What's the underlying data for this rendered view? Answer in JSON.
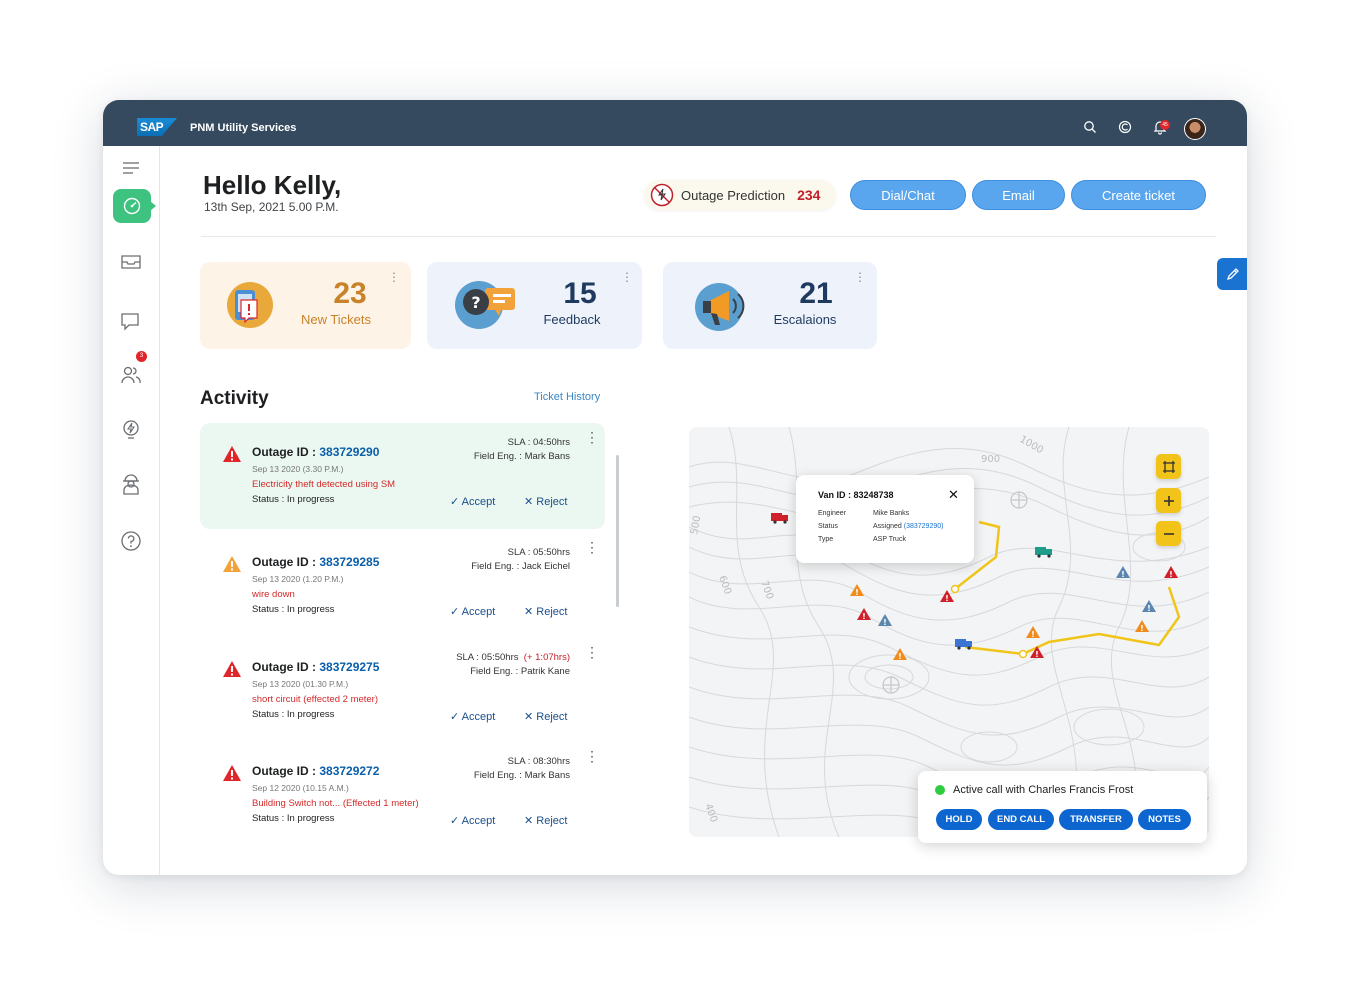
{
  "shell": {
    "logo_text": "SAP",
    "app_title": "PNM Utility Services",
    "notification_count": "45",
    "icons": [
      "search-icon",
      "copilot-icon",
      "bell-icon",
      "avatar"
    ]
  },
  "sidebar": {
    "items": [
      {
        "icon": "menu-icon"
      },
      {
        "icon": "dashboard-icon",
        "active": true
      },
      {
        "icon": "inbox-icon"
      },
      {
        "icon": "chat-icon",
        "badge": "3"
      },
      {
        "icon": "users-icon"
      },
      {
        "icon": "energy-icon"
      },
      {
        "icon": "engineer-icon"
      },
      {
        "icon": "help-icon"
      }
    ]
  },
  "header": {
    "greeting": "Hello Kelly,",
    "date": "13th Sep, 2021  5.00 P.M.",
    "outage_label": "Outage Prediction",
    "outage_value": "234",
    "buttons": {
      "dial": "Dial/Chat",
      "email": "Email",
      "create": "Create ticket"
    }
  },
  "kpis": [
    {
      "value": "23",
      "label": "New Tickets",
      "color": "#c8832a",
      "bg": "#fdf3e7"
    },
    {
      "value": "15",
      "label": "Feedback",
      "color": "#1f3a5f",
      "bg": "#eef2fb"
    },
    {
      "value": "21",
      "label": "Escalaions",
      "color": "#1f3a5f",
      "bg": "#eef2fb"
    }
  ],
  "activity": {
    "title": "Activity",
    "history_link": "Ticket History",
    "accept_label": "Accept",
    "reject_label": "Reject",
    "id_label": "Outage ID : ",
    "tickets": [
      {
        "id": "383729290",
        "date": "Sep 13 2020 (3.30 P.M.)",
        "desc": "Electricity theft detected using SM",
        "status": "Status  :  In progress",
        "sla": "SLA : 04:50hrs",
        "sla_extra": "",
        "field_eng": "Field Eng. :  Mark Bans",
        "severity": "high"
      },
      {
        "id": "383729285",
        "date": "Sep 13 2020 (1.20 P.M.)",
        "desc": "wire down",
        "status": "Status  :  In progress",
        "sla": "SLA : 05:50hrs",
        "sla_extra": "",
        "field_eng": "Field Eng. :  Jack Eichel",
        "severity": "medium"
      },
      {
        "id": "383729275",
        "date": "Sep 13 2020 (01.30 P.M.)",
        "desc": "short circuit  (effected 2 meter)",
        "status": "Status  :  In progress",
        "sla": "SLA : 05:50hrs",
        "sla_extra": "(+ 1:07hrs)",
        "field_eng": "Field Eng. :  Patrik Kane",
        "severity": "high"
      },
      {
        "id": "383729272",
        "date": "Sep 12 2020 (10.15 A.M.)",
        "desc": "Building Switch not... (Effected 1 meter)",
        "status": "Status  :  In progress",
        "sla": "SLA : 08:30hrs",
        "sla_extra": "",
        "field_eng": "Field Eng. :  Mark Bans",
        "severity": "high"
      }
    ]
  },
  "map": {
    "contour_labels": [
      "1000",
      "900",
      "500",
      "600",
      "700",
      "400"
    ],
    "popup": {
      "title": "Van ID : 83248738",
      "rows": [
        {
          "key": "Engineer",
          "value": "Mike Banks",
          "link": ""
        },
        {
          "key": "Status",
          "value": "Assigned ",
          "link": "(383729290)"
        },
        {
          "key": "Type",
          "value": "ASP Truck",
          "link": ""
        }
      ]
    },
    "call": {
      "text": "Active call with Charles Francis Frost",
      "buttons": [
        "HOLD",
        "END CALL",
        "TRANSFER",
        "NOTES"
      ]
    }
  }
}
